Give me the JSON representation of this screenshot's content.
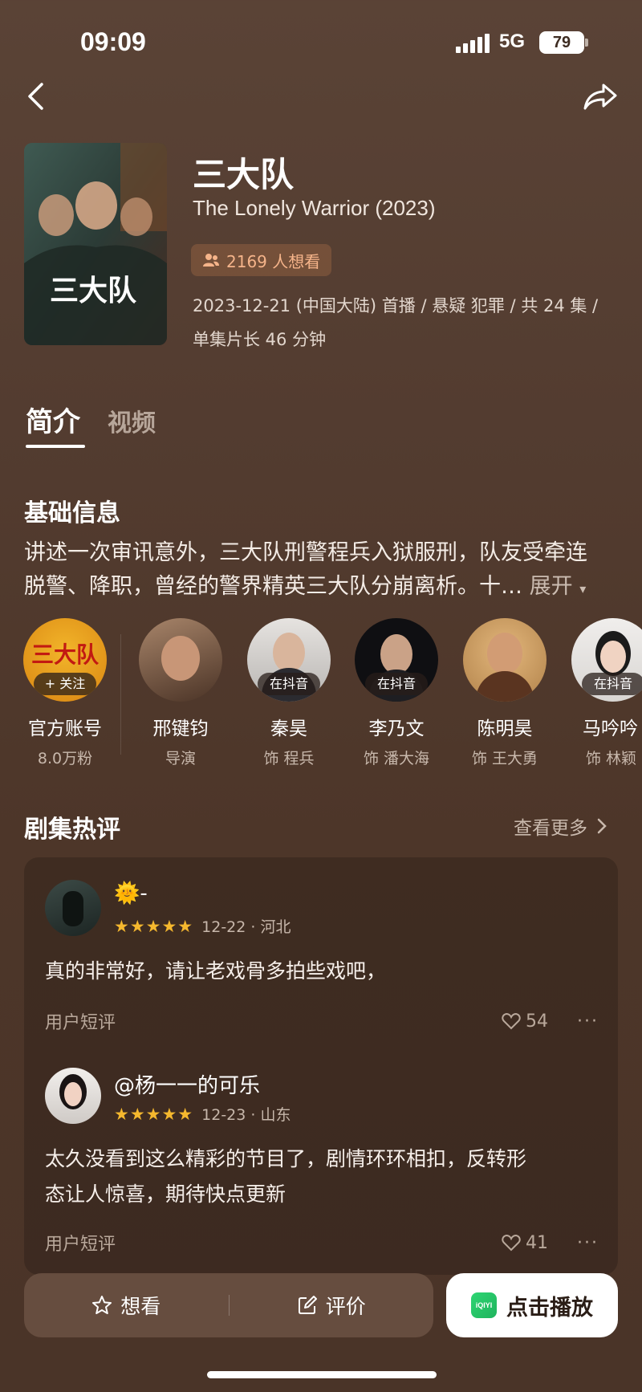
{
  "status": {
    "time": "09:09",
    "network": "5G",
    "battery": "79"
  },
  "show": {
    "title": "三大队",
    "english_title": "The Lonely Warrior (2023)",
    "want_count": "2169 人想看",
    "meta_line1": "2023-12-21 (中国大陆) 首播 / 悬疑 犯罪 / 共 24 集 /",
    "meta_line2": "单集片长 46 分钟",
    "poster_text": "三大队"
  },
  "tabs": [
    {
      "label": "简介",
      "active": true
    },
    {
      "label": "视频",
      "active": false
    }
  ],
  "basic_info": {
    "title": "基础信息",
    "line1": "讲述一次审讯意外，三大队刑警程兵入狱服刑，队友受牵连",
    "line2": "脱警、降职，曾经的警界精英三大队分崩离析。十…",
    "expand": "展开"
  },
  "cast": [
    {
      "name": "官方账号",
      "sub": "8.0万粉",
      "badge": "+ 关注",
      "avatar_text": "三大队"
    },
    {
      "name": "邢键钧",
      "sub": "导演",
      "badge": ""
    },
    {
      "name": "秦昊",
      "sub": "饰 程兵",
      "badge": "在抖音"
    },
    {
      "name": "李乃文",
      "sub": "饰 潘大海",
      "badge": "在抖音"
    },
    {
      "name": "陈明昊",
      "sub": "饰 王大勇",
      "badge": ""
    },
    {
      "name": "马吟吟",
      "sub": "饰 林颖",
      "badge": "在抖音"
    }
  ],
  "reviews_section": {
    "title": "剧集热评",
    "more": "查看更多"
  },
  "reviews": [
    {
      "user": "🌞-",
      "stars": "★★★★★",
      "date": "12-22 · 河北",
      "text_line1": "真的非常好，请让老戏骨多拍些戏吧，",
      "text_line2": "",
      "tag": "用户短评",
      "likes": "54",
      "more": "···"
    },
    {
      "user": "@杨一一的可乐",
      "stars": "★★★★★",
      "date": "12-23 · 山东",
      "text_line1": "太久没看到这么精彩的节目了，剧情环环相扣，反转形",
      "text_line2": "态让人惊喜，期待快点更新",
      "tag": "用户短评",
      "likes": "41",
      "more": "···"
    }
  ],
  "bottom_bar": {
    "want": "想看",
    "rate": "评价",
    "play": "点击播放",
    "play_logo": "iQIYI"
  }
}
